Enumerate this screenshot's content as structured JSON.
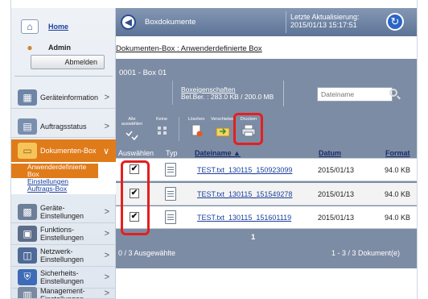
{
  "sidebar": {
    "home_label": "Home",
    "user_label": "Admin",
    "logout_label": "Abmelden",
    "menu": [
      {
        "label": "Geräteinformation",
        "icon": "device-info-icon"
      },
      {
        "label": "Auftragsstatus",
        "icon": "job-status-icon"
      },
      {
        "label": "Dokumenten-Box",
        "icon": "document-box-icon"
      },
      {
        "label": "Geräte-\nEinstellungen",
        "icon": "device-settings-icon"
      },
      {
        "label": "Funktions-\nEinstellungen",
        "icon": "function-settings-icon"
      },
      {
        "label": "Netzwerk-\nEinstellungen",
        "icon": "network-settings-icon"
      },
      {
        "label": "Sicherheits-\nEinstellungen",
        "icon": "security-settings-icon"
      },
      {
        "label": "Management-\nEinstellungen",
        "icon": "management-settings-icon"
      }
    ],
    "submenu": {
      "current": "Anwenderdefinierte Box",
      "items": [
        "Einstellungen",
        "Auftrags-Box"
      ]
    }
  },
  "topbar": {
    "title": "Boxdokumente",
    "last_update_label": "Letzte Aktualisierung:",
    "last_update_value": "2015/01/13 15:17:51"
  },
  "breadcrumb": "Dokumenten-Box : Anwenderdefinierte Box",
  "box": {
    "title": "0001 - Box 01",
    "properties_label": "Boxeigenschaften",
    "usage_label": "Bel.Ber. : 283.0 KB / 200.0 MB",
    "filename_placeholder": "Dateiname"
  },
  "toolbar": {
    "select_all": "Alle auswählen",
    "none": "Keine",
    "delete": "Löschen",
    "move": "Verschieben",
    "print": "Drucken"
  },
  "table": {
    "headers": {
      "select": "Auswählen",
      "type": "Typ",
      "filename": "Dateiname ▲",
      "date": "Datum",
      "format": "Format"
    },
    "rows": [
      {
        "checked": "✔",
        "filename": "TEST.txt_130115_150923099",
        "date": "2015/01/13",
        "size": "94.0 KB"
      },
      {
        "checked": "✔",
        "filename": "TEST.txt_130115_151549278",
        "date": "2015/01/13",
        "size": "94.0 KB"
      },
      {
        "checked": "✔",
        "filename": "TEST.txt_130115_151601119",
        "date": "2015/01/13",
        "size": "94.0 KB"
      }
    ]
  },
  "pagination": {
    "current_page": "1"
  },
  "footer": {
    "selected": "0 / 3 Ausgewählte",
    "range": "1 - 3 / 3 Dokument(e)"
  },
  "colors": {
    "accent_orange": "#e07b1a",
    "highlight_red": "#e41f1f",
    "panel": "#7c8ca4"
  }
}
